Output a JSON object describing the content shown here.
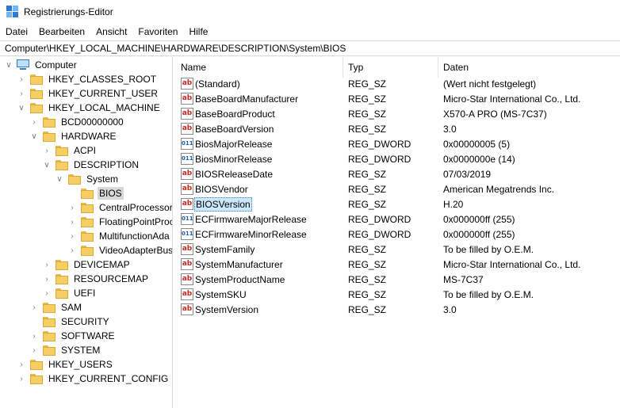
{
  "window": {
    "title": "Registrierungs-Editor"
  },
  "menu": [
    "Datei",
    "Bearbeiten",
    "Ansicht",
    "Favoriten",
    "Hilfe"
  ],
  "address": "Computer\\HKEY_LOCAL_MACHINE\\HARDWARE\\DESCRIPTION\\System\\BIOS",
  "tree": [
    {
      "label": "Computer",
      "level": 0,
      "chevron": "v",
      "icon": "computer"
    },
    {
      "label": "HKEY_CLASSES_ROOT",
      "level": 1,
      "chevron": ">"
    },
    {
      "label": "HKEY_CURRENT_USER",
      "level": 1,
      "chevron": ">"
    },
    {
      "label": "HKEY_LOCAL_MACHINE",
      "level": 1,
      "chevron": "v"
    },
    {
      "label": "BCD00000000",
      "level": 2,
      "chevron": ">"
    },
    {
      "label": "HARDWARE",
      "level": 2,
      "chevron": "v"
    },
    {
      "label": "ACPI",
      "level": 3,
      "chevron": ">"
    },
    {
      "label": "DESCRIPTION",
      "level": 3,
      "chevron": "v"
    },
    {
      "label": "System",
      "level": 4,
      "chevron": "v"
    },
    {
      "label": "BIOS",
      "level": 5,
      "chevron": "",
      "selected": true
    },
    {
      "label": "CentralProcessor",
      "level": 5,
      "chevron": ">"
    },
    {
      "label": "FloatingPointProc",
      "level": 5,
      "chevron": ">"
    },
    {
      "label": "MultifunctionAda",
      "level": 5,
      "chevron": ">"
    },
    {
      "label": "VideoAdapterBus",
      "level": 5,
      "chevron": ">"
    },
    {
      "label": "DEVICEMAP",
      "level": 3,
      "chevron": ">"
    },
    {
      "label": "RESOURCEMAP",
      "level": 3,
      "chevron": ">"
    },
    {
      "label": "UEFI",
      "level": 3,
      "chevron": ">"
    },
    {
      "label": "SAM",
      "level": 2,
      "chevron": ">"
    },
    {
      "label": "SECURITY",
      "level": 2,
      "chevron": ""
    },
    {
      "label": "SOFTWARE",
      "level": 2,
      "chevron": ">"
    },
    {
      "label": "SYSTEM",
      "level": 2,
      "chevron": ">"
    },
    {
      "label": "HKEY_USERS",
      "level": 1,
      "chevron": ">"
    },
    {
      "label": "HKEY_CURRENT_CONFIG",
      "level": 1,
      "chevron": ">"
    }
  ],
  "columns": {
    "name": "Name",
    "type": "Typ",
    "data": "Daten"
  },
  "values": [
    {
      "name": "(Standard)",
      "type": "REG_SZ",
      "data": "(Wert nicht festgelegt)",
      "icon": "ab"
    },
    {
      "name": "BaseBoardManufacturer",
      "type": "REG_SZ",
      "data": "Micro-Star International Co., Ltd.",
      "icon": "ab"
    },
    {
      "name": "BaseBoardProduct",
      "type": "REG_SZ",
      "data": "X570-A PRO (MS-7C37)",
      "icon": "ab"
    },
    {
      "name": "BaseBoardVersion",
      "type": "REG_SZ",
      "data": "3.0",
      "icon": "ab"
    },
    {
      "name": "BiosMajorRelease",
      "type": "REG_DWORD",
      "data": "0x00000005 (5)",
      "icon": "dw"
    },
    {
      "name": "BiosMinorRelease",
      "type": "REG_DWORD",
      "data": "0x0000000e (14)",
      "icon": "dw"
    },
    {
      "name": "BIOSReleaseDate",
      "type": "REG_SZ",
      "data": "07/03/2019",
      "icon": "ab"
    },
    {
      "name": "BIOSVendor",
      "type": "REG_SZ",
      "data": "American Megatrends Inc.",
      "icon": "ab"
    },
    {
      "name": "BIOSVersion",
      "type": "REG_SZ",
      "data": "H.20",
      "icon": "ab",
      "selected": true
    },
    {
      "name": "ECFirmwareMajorRelease",
      "type": "REG_DWORD",
      "data": "0x000000ff (255)",
      "icon": "dw"
    },
    {
      "name": "ECFirmwareMinorRelease",
      "type": "REG_DWORD",
      "data": "0x000000ff (255)",
      "icon": "dw"
    },
    {
      "name": "SystemFamily",
      "type": "REG_SZ",
      "data": "To be filled by O.E.M.",
      "icon": "ab"
    },
    {
      "name": "SystemManufacturer",
      "type": "REG_SZ",
      "data": "Micro-Star International Co., Ltd.",
      "icon": "ab"
    },
    {
      "name": "SystemProductName",
      "type": "REG_SZ",
      "data": "MS-7C37",
      "icon": "ab"
    },
    {
      "name": "SystemSKU",
      "type": "REG_SZ",
      "data": "To be filled by O.E.M.",
      "icon": "ab"
    },
    {
      "name": "SystemVersion",
      "type": "REG_SZ",
      "data": "3.0",
      "icon": "ab"
    }
  ],
  "icon_text": {
    "ab": "ab",
    "dw": "011"
  }
}
